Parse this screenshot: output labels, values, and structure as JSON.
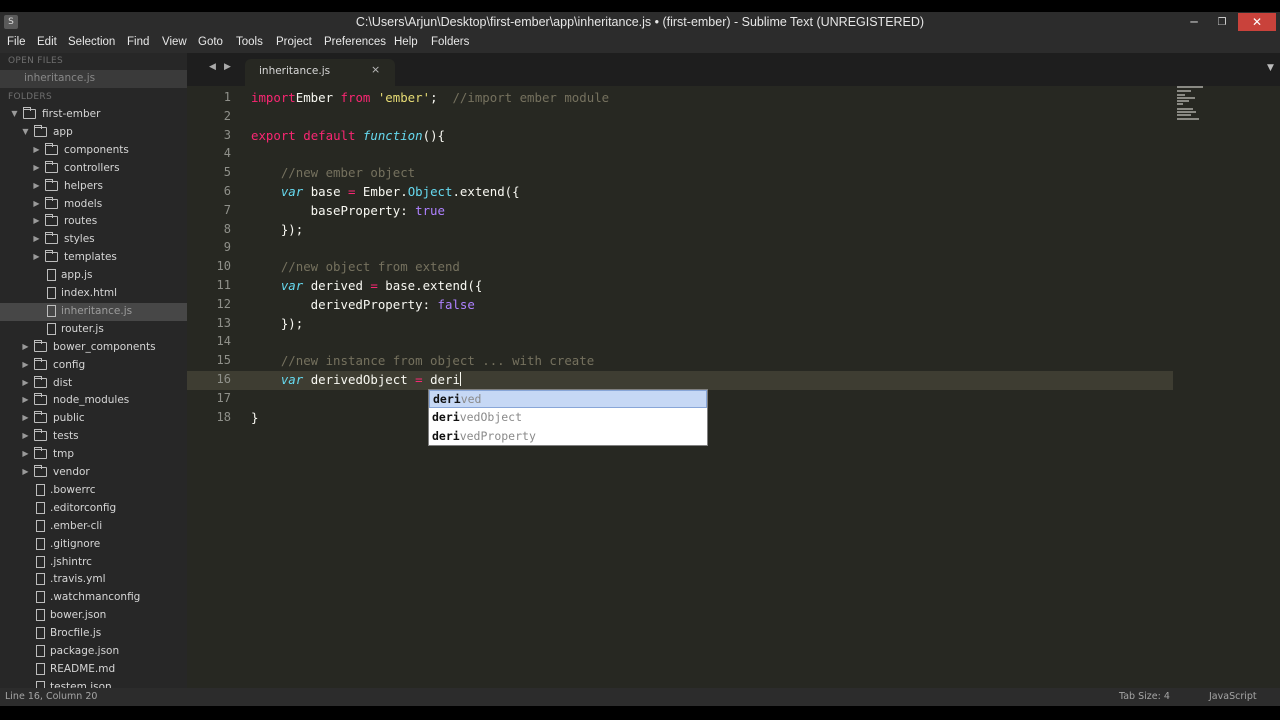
{
  "window": {
    "title": "C:\\Users\\Arjun\\Desktop\\first-ember\\app\\inheritance.js • (first-ember) - Sublime Text (UNREGISTERED)",
    "min_glyph": "─",
    "max_glyph": "❐",
    "close_glyph": "✕",
    "app_icon": "S"
  },
  "menu": [
    "File",
    "Edit",
    "Selection",
    "Find",
    "View",
    "Goto",
    "Tools",
    "Project",
    "Preferences",
    "Help",
    "Folders"
  ],
  "sidebar": {
    "open_files_header": "OPEN FILES",
    "open_files": [
      "inheritance.js"
    ],
    "folders_header": "FOLDERS",
    "tree": [
      {
        "label": "first-ember",
        "type": "folder",
        "depth": 0,
        "expanded": true
      },
      {
        "label": "app",
        "type": "folder",
        "depth": 1,
        "expanded": true
      },
      {
        "label": "components",
        "type": "folder",
        "depth": 2,
        "expanded": false
      },
      {
        "label": "controllers",
        "type": "folder",
        "depth": 2,
        "expanded": false
      },
      {
        "label": "helpers",
        "type": "folder",
        "depth": 2,
        "expanded": false
      },
      {
        "label": "models",
        "type": "folder",
        "depth": 2,
        "expanded": false
      },
      {
        "label": "routes",
        "type": "folder",
        "depth": 2,
        "expanded": false
      },
      {
        "label": "styles",
        "type": "folder",
        "depth": 2,
        "expanded": false
      },
      {
        "label": "templates",
        "type": "folder",
        "depth": 2,
        "expanded": false
      },
      {
        "label": "app.js",
        "type": "file",
        "depth": 2
      },
      {
        "label": "index.html",
        "type": "file",
        "depth": 2
      },
      {
        "label": "inheritance.js",
        "type": "file",
        "depth": 2,
        "selected": true
      },
      {
        "label": "router.js",
        "type": "file",
        "depth": 2
      },
      {
        "label": "bower_components",
        "type": "folder",
        "depth": 1,
        "expanded": false
      },
      {
        "label": "config",
        "type": "folder",
        "depth": 1,
        "expanded": false
      },
      {
        "label": "dist",
        "type": "folder",
        "depth": 1,
        "expanded": false
      },
      {
        "label": "node_modules",
        "type": "folder",
        "depth": 1,
        "expanded": false
      },
      {
        "label": "public",
        "type": "folder",
        "depth": 1,
        "expanded": false
      },
      {
        "label": "tests",
        "type": "folder",
        "depth": 1,
        "expanded": false
      },
      {
        "label": "tmp",
        "type": "folder",
        "depth": 1,
        "expanded": false
      },
      {
        "label": "vendor",
        "type": "folder",
        "depth": 1,
        "expanded": false
      },
      {
        "label": ".bowerrc",
        "type": "file",
        "depth": 1
      },
      {
        "label": ".editorconfig",
        "type": "file",
        "depth": 1
      },
      {
        "label": ".ember-cli",
        "type": "file",
        "depth": 1
      },
      {
        "label": ".gitignore",
        "type": "file",
        "depth": 1
      },
      {
        "label": ".jshintrc",
        "type": "file",
        "depth": 1
      },
      {
        "label": ".travis.yml",
        "type": "file",
        "depth": 1
      },
      {
        "label": ".watchmanconfig",
        "type": "file",
        "depth": 1
      },
      {
        "label": "bower.json",
        "type": "file",
        "depth": 1
      },
      {
        "label": "Brocfile.js",
        "type": "file",
        "depth": 1
      },
      {
        "label": "package.json",
        "type": "file",
        "depth": 1
      },
      {
        "label": "README.md",
        "type": "file",
        "depth": 1
      },
      {
        "label": "testem.json",
        "type": "file",
        "depth": 1
      }
    ]
  },
  "tabs": {
    "nav_left": "◀",
    "nav_right": "▶",
    "active_label": "inheritance.js",
    "close_glyph": "×",
    "menu_glyph": "▼"
  },
  "code": {
    "active_line": 16,
    "lines": [
      {
        "n": "1",
        "tokens": [
          [
            "k",
            "import"
          ],
          [
            "",
            "Ember "
          ],
          [
            "k",
            "from"
          ],
          [
            "",
            " "
          ],
          [
            "s",
            "'ember'"
          ],
          [
            "",
            ";  "
          ],
          [
            "c",
            "//import ember module"
          ]
        ]
      },
      {
        "n": "2",
        "tokens": []
      },
      {
        "n": "3",
        "tokens": [
          [
            "k",
            "export"
          ],
          [
            "",
            " "
          ],
          [
            "k",
            "default"
          ],
          [
            "",
            " "
          ],
          [
            "f",
            "function"
          ],
          [
            "",
            "(){"
          ]
        ]
      },
      {
        "n": "4",
        "tokens": []
      },
      {
        "n": "5",
        "tokens": [
          [
            "",
            "    "
          ],
          [
            "c",
            "//new ember object"
          ]
        ]
      },
      {
        "n": "6",
        "tokens": [
          [
            "",
            "    "
          ],
          [
            "f",
            "var"
          ],
          [
            "",
            " base "
          ],
          [
            "k",
            "="
          ],
          [
            "",
            " Ember."
          ],
          [
            "cls",
            "Object"
          ],
          [
            "",
            ".extend({"
          ]
        ]
      },
      {
        "n": "7",
        "tokens": [
          [
            "",
            "        baseProperty: "
          ],
          [
            "n",
            "true"
          ]
        ]
      },
      {
        "n": "8",
        "tokens": [
          [
            "",
            "    });"
          ]
        ]
      },
      {
        "n": "9",
        "tokens": []
      },
      {
        "n": "10",
        "tokens": [
          [
            "",
            "    "
          ],
          [
            "c",
            "//new object from extend"
          ]
        ]
      },
      {
        "n": "11",
        "tokens": [
          [
            "",
            "    "
          ],
          [
            "f",
            "var"
          ],
          [
            "",
            " derived "
          ],
          [
            "k",
            "="
          ],
          [
            "",
            " base.extend({"
          ]
        ]
      },
      {
        "n": "12",
        "tokens": [
          [
            "",
            "        derivedProperty: "
          ],
          [
            "n",
            "false"
          ]
        ]
      },
      {
        "n": "13",
        "tokens": [
          [
            "",
            "    });"
          ]
        ]
      },
      {
        "n": "14",
        "tokens": []
      },
      {
        "n": "15",
        "tokens": [
          [
            "",
            "    "
          ],
          [
            "c",
            "//new instance from object ... with create"
          ]
        ]
      },
      {
        "n": "16",
        "tokens": [
          [
            "",
            "    "
          ],
          [
            "f",
            "var"
          ],
          [
            "",
            " derivedObject "
          ],
          [
            "k",
            "="
          ],
          [
            "",
            " deri"
          ]
        ]
      },
      {
        "n": "17",
        "tokens": []
      },
      {
        "n": "18",
        "tokens": [
          [
            "",
            "}"
          ]
        ]
      }
    ]
  },
  "autocomplete": {
    "typed": "deri",
    "items": [
      {
        "match": "deri",
        "rest": "ved"
      },
      {
        "match": "deri",
        "rest": "vedObject"
      },
      {
        "match": "deri",
        "rest": "vedProperty"
      }
    ]
  },
  "status": {
    "position": "Line 16, Column 20",
    "tab_size": "Tab Size: 4",
    "syntax": "JavaScript"
  }
}
